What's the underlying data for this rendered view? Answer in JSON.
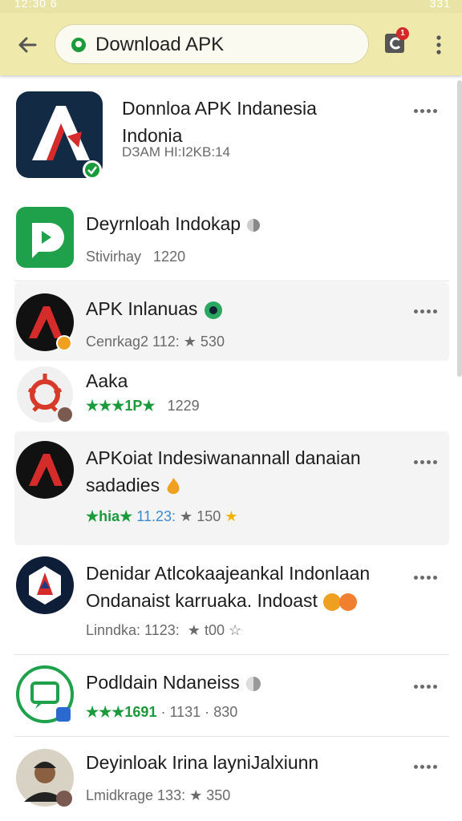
{
  "status_bar": {
    "left": "12:30  6",
    "right": "331"
  },
  "url_bar": {
    "text": "Download APK",
    "tab_count": "1"
  },
  "results": [
    {
      "title_line1": "Donnloa APK Indanesia",
      "title_line2": "Indonia",
      "meta": "DЗAM HI:I2KB:14"
    },
    {
      "title": "Deyrnloah Indokap",
      "meta_left": "Stivirhay",
      "meta_right": "1220"
    },
    {
      "title": "APK Inlanuas",
      "meta_left": "Cenrkag2 112:",
      "meta_right": "530"
    },
    {
      "title": "Aaka",
      "rating_text": "★★★1P★",
      "meta_right": "1229"
    },
    {
      "title_line1": "APKoiat Indesiwanannall danaian",
      "title_line2": "sadadies",
      "rating_text": "★hia★",
      "meta_mid": "11.23:",
      "meta_right": "150"
    },
    {
      "title_line1": "Denidar Atlcokaajeankal Indonlaan",
      "title_line2": "Ondanaist karruaka. Indoast",
      "meta_left": "Linndka: 1123:",
      "meta_right": "t00"
    },
    {
      "title": "Podldain Ndaneiss",
      "rating_text": "★★★1691",
      "meta_mid": "· 1131 ·",
      "meta_right": "830"
    },
    {
      "title": "Deyinloak  Irina layniJalxiunn",
      "meta_left": "Lmidkrage 133:",
      "meta_right": "350"
    }
  ],
  "colors": {
    "toolbar": "#efeaab",
    "accent_green": "#1a9a3a",
    "badge_red": "#d62828"
  }
}
